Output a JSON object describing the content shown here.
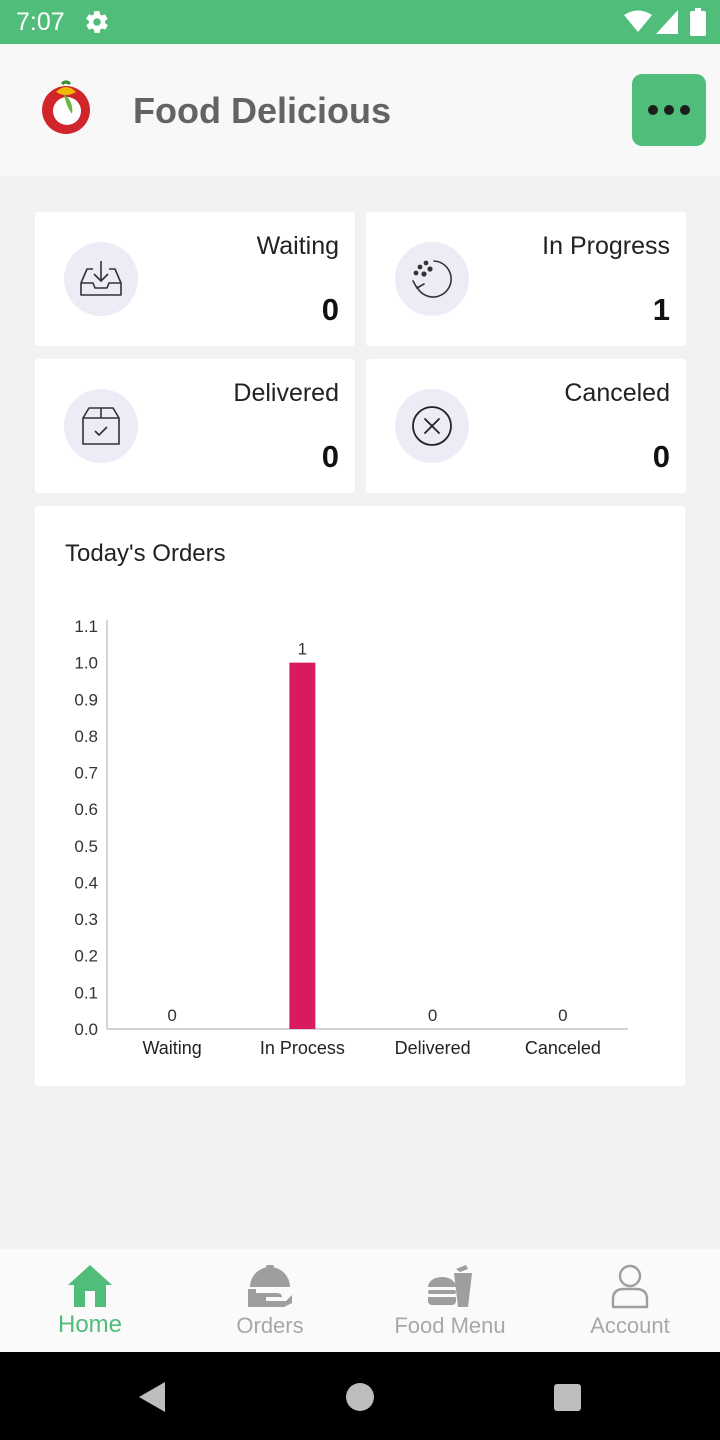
{
  "status_bar": {
    "time": "7:07",
    "icons": [
      "gear-icon",
      "wifi-icon",
      "signal-icon",
      "battery-icon"
    ]
  },
  "header": {
    "title": "Food Delicious",
    "menu_icon": "more-horizontal-icon"
  },
  "stats": [
    {
      "label": "Waiting",
      "value": "0",
      "icon": "inbox-icon"
    },
    {
      "label": "In Progress",
      "value": "1",
      "icon": "progress-icon"
    },
    {
      "label": "Delivered",
      "value": "0",
      "icon": "package-check-icon"
    },
    {
      "label": "Canceled",
      "value": "0",
      "icon": "cancel-circle-icon"
    }
  ],
  "chart": {
    "title": "Today's Orders",
    "chart_data": {
      "type": "bar",
      "categories": [
        "Waiting",
        "In Process",
        "Delivered",
        "Canceled"
      ],
      "values": [
        0,
        1,
        0,
        0
      ],
      "data_labels": [
        "0",
        "1",
        "0",
        "0"
      ],
      "title": "Today's Orders",
      "xlabel": "",
      "ylabel": "",
      "ylim": [
        0,
        1.1
      ],
      "y_ticks": [
        "0.0",
        "0.1",
        "0.2",
        "0.3",
        "0.4",
        "0.5",
        "0.6",
        "0.7",
        "0.8",
        "0.9",
        "1.0",
        "1.1"
      ],
      "bar_color": "#d81b60",
      "grid": false,
      "legend": "none"
    }
  },
  "bottom_nav": [
    {
      "label": "Home",
      "icon": "home-icon",
      "active": true
    },
    {
      "label": "Orders",
      "icon": "serving-dish-icon",
      "active": false
    },
    {
      "label": "Food Menu",
      "icon": "fast-food-icon",
      "active": false
    },
    {
      "label": "Account",
      "icon": "person-icon",
      "active": false
    }
  ],
  "colors": {
    "accent": "#51bd7a",
    "bar": "#d81b60",
    "inactive": "#a8a8a8"
  }
}
